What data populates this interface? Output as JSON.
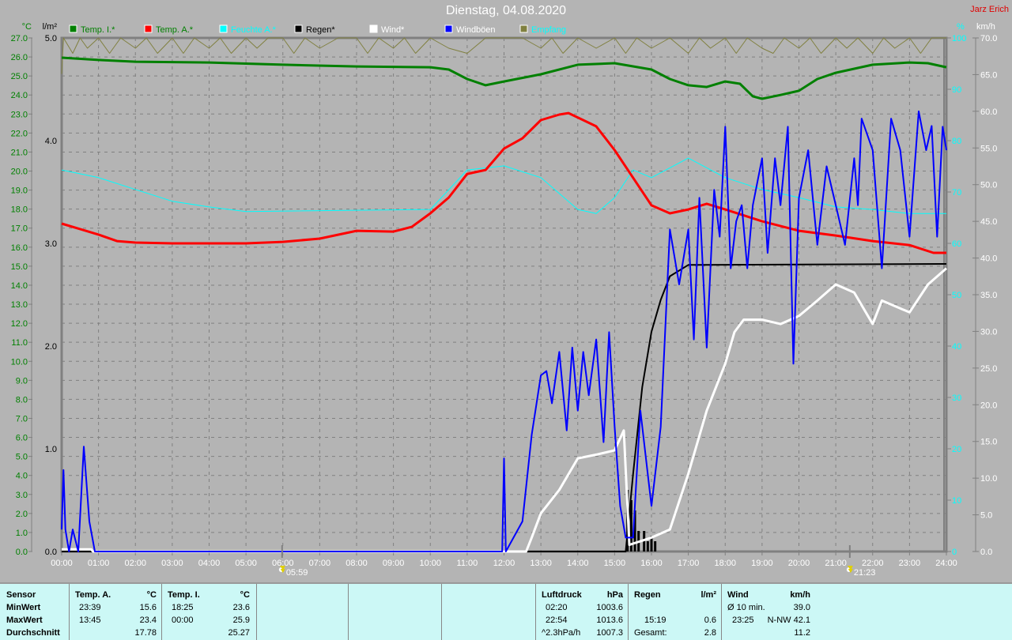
{
  "header": {
    "title": "Dienstag, 04.08.2020",
    "author": "Jarz Erich"
  },
  "chart_data": {
    "type": "line",
    "title": "Dienstag, 04.08.2020",
    "x_unit": "hours",
    "xlim": [
      0,
      24
    ],
    "x_ticks": [
      "00:00",
      "01:00",
      "02:00",
      "03:00",
      "04:00",
      "05:00",
      "06:00",
      "07:00",
      "08:00",
      "09:00",
      "10:00",
      "11:00",
      "12:00",
      "13:00",
      "14:00",
      "15:00",
      "16:00",
      "17:00",
      "18:00",
      "19:00",
      "20:00",
      "21:00",
      "22:00",
      "23:00",
      "24:00"
    ],
    "axes": {
      "temp": {
        "label": "°C",
        "ylim": [
          0,
          27
        ],
        "step": 1,
        "color": "#008000"
      },
      "rain": {
        "label": "l/m²",
        "ylim": [
          0,
          5
        ],
        "step": 1,
        "color": "#000000"
      },
      "humidity": {
        "label": "%",
        "ylim": [
          0,
          100
        ],
        "step": 10,
        "color": "#00ffff"
      },
      "wind": {
        "label": "km/h",
        "ylim": [
          0,
          70
        ],
        "step": 5,
        "color": "#ffffff"
      }
    },
    "sun": {
      "sunrise": "05:59",
      "sunset": "21:23",
      "sunrise_h": 5.98,
      "sunset_h": 21.38
    },
    "legend": [
      {
        "name": "Temp. I.*",
        "color": "#008000",
        "text_color": "#008000"
      },
      {
        "name": "Temp. A.*",
        "color": "#ff0000",
        "text_color": "#008000"
      },
      {
        "name": "Feuchte A.*",
        "color": "#00ffff",
        "text_color": "#00ffff"
      },
      {
        "name": "Regen*",
        "color": "#000000",
        "text_color": "#000000"
      },
      {
        "name": "Wind*",
        "color": "#ffffff",
        "text_color": "#ffffff"
      },
      {
        "name": "Windböen",
        "color": "#0000ff",
        "text_color": "#ffffff"
      },
      {
        "name": "Empfang",
        "color": "#808040",
        "text_color": "#00ffff"
      }
    ],
    "series": [
      {
        "name": "Empfang",
        "axis": "humidity",
        "color": "#808040",
        "width": 1,
        "x": [
          0,
          0.05,
          0.3,
          0.5,
          0.7,
          1,
          1.3,
          1.6,
          2,
          2.3,
          2.6,
          3,
          3.3,
          3.6,
          4,
          4.3,
          4.6,
          5,
          5.3,
          5.6,
          6,
          6.3,
          6.6,
          7,
          7.5,
          8,
          8.3,
          8.6,
          9,
          9.3,
          9.6,
          10,
          10.5,
          11,
          11.5,
          12,
          12.5,
          13,
          13.3,
          13.6,
          14,
          14.5,
          15,
          15.3,
          15.6,
          16,
          16.5,
          17,
          17.3,
          17.6,
          18,
          18.3,
          18.6,
          19,
          19.3,
          19.6,
          20,
          20.3,
          20.6,
          21,
          21.3,
          21.6,
          22,
          22.3,
          22.6,
          23,
          23.3,
          23.6,
          24
        ],
        "y": [
          93,
          100,
          97,
          100,
          98,
          100,
          97,
          100,
          98,
          100,
          97,
          100,
          97,
          100,
          98,
          100,
          97,
          100,
          98,
          100,
          100,
          97,
          100,
          98,
          100,
          100,
          97,
          100,
          98,
          100,
          97,
          100,
          98,
          97,
          100,
          100,
          100,
          98,
          100,
          97,
          100,
          98,
          100,
          97,
          100,
          98,
          100,
          97,
          100,
          98,
          100,
          97,
          100,
          98,
          97,
          100,
          98,
          100,
          97,
          100,
          98,
          100,
          97,
          100,
          98,
          100,
          97,
          100,
          100
        ]
      },
      {
        "name": "Temp. I.*",
        "axis": "temp",
        "color": "#008000",
        "width": 3,
        "x": [
          0,
          1,
          2,
          4,
          6,
          8,
          10,
          10.5,
          11,
          11.5,
          12,
          13,
          14,
          15,
          16,
          16.5,
          17,
          17.5,
          18,
          18.4,
          18.75,
          19,
          19.5,
          20,
          20.5,
          21,
          22,
          23,
          23.5,
          24
        ],
        "y": [
          25.96,
          25.84,
          25.75,
          25.71,
          25.59,
          25.5,
          25.46,
          25.34,
          24.84,
          24.51,
          24.71,
          25.09,
          25.59,
          25.67,
          25.34,
          24.84,
          24.51,
          24.42,
          24.71,
          24.59,
          23.93,
          23.8,
          24.0,
          24.22,
          24.84,
          25.17,
          25.59,
          25.71,
          25.67,
          25.46
        ]
      },
      {
        "name": "Feuchte A.*",
        "axis": "humidity",
        "color": "#00ffff",
        "width": 1,
        "x": [
          0,
          1,
          2,
          3,
          4,
          5,
          10,
          11,
          12,
          13,
          14,
          14.5,
          15,
          15.5,
          16,
          17,
          18,
          19,
          20,
          21,
          22,
          23,
          24
        ],
        "y": [
          74.3,
          72.8,
          70.5,
          68.2,
          67.1,
          66.2,
          66.6,
          74.3,
          75.1,
          72.8,
          66.6,
          65.8,
          68.9,
          74.3,
          72.8,
          76.6,
          72.8,
          70.5,
          68.9,
          67.1,
          66.6,
          65.8,
          65.8
        ]
      },
      {
        "name": "Regen*",
        "axis": "rain",
        "color": "#000000",
        "width": 2,
        "x": [
          0,
          15.3,
          15.5,
          15.75,
          16,
          16.25,
          16.5,
          17,
          24
        ],
        "y": [
          0,
          0,
          0.75,
          1.6,
          2.14,
          2.45,
          2.68,
          2.79,
          2.8
        ]
      },
      {
        "name": "Wind*",
        "axis": "wind",
        "color": "#ffffff",
        "width": 3,
        "x": [
          0,
          0.8,
          0.85,
          12.6,
          12.75,
          13,
          13.5,
          14,
          14.5,
          15,
          15.25,
          15.4,
          16,
          16.5,
          17,
          17.5,
          18,
          18.25,
          18.5,
          19,
          19.5,
          20,
          20.5,
          21,
          21.5,
          22,
          22.25,
          23,
          23.5,
          24
        ],
        "y": [
          0.3,
          0.3,
          0,
          0,
          1.9,
          5.2,
          8.4,
          12.7,
          13.2,
          13.8,
          16.5,
          0.9,
          1.9,
          3.0,
          10.6,
          19.2,
          25.6,
          29.9,
          31.6,
          31.6,
          31.0,
          32.1,
          34.2,
          36.4,
          35.3,
          31.0,
          34.2,
          32.6,
          36.4,
          38.6
        ]
      },
      {
        "name": "Temp. A.*",
        "axis": "temp",
        "color": "#ff0000",
        "width": 3,
        "x": [
          0,
          0.5,
          1,
          1.5,
          2,
          3,
          5,
          6,
          7,
          8,
          9,
          9.5,
          10,
          10.5,
          11,
          11.5,
          12,
          12.5,
          13,
          13.5,
          13.75,
          14.5,
          15,
          15.5,
          16,
          16.5,
          17,
          17.5,
          18,
          19,
          20,
          21,
          22,
          23,
          23.65,
          24
        ],
        "y": [
          17.24,
          16.95,
          16.66,
          16.32,
          16.24,
          16.2,
          16.2,
          16.28,
          16.45,
          16.86,
          16.82,
          17.07,
          17.78,
          18.61,
          19.85,
          20.06,
          21.18,
          21.72,
          22.68,
          22.97,
          23.05,
          22.35,
          21.1,
          19.65,
          18.2,
          17.78,
          17.98,
          18.28,
          17.98,
          17.36,
          16.86,
          16.61,
          16.32,
          16.11,
          15.7,
          15.7
        ]
      },
      {
        "name": "Windböen",
        "axis": "wind",
        "color": "#0000ff",
        "width": 2,
        "x": [
          0,
          0.05,
          0.1,
          0.2,
          0.3,
          0.45,
          0.6,
          0.75,
          0.9,
          1.05,
          11.95,
          12,
          12.05,
          12.5,
          12.75,
          13,
          13.15,
          13.3,
          13.5,
          13.7,
          13.85,
          14,
          14.15,
          14.3,
          14.5,
          14.7,
          14.85,
          15,
          15.15,
          15.3,
          15.5,
          15.7,
          16,
          16.25,
          16.5,
          16.75,
          17,
          17.15,
          17.3,
          17.5,
          17.7,
          17.85,
          18,
          18.15,
          18.3,
          18.45,
          18.6,
          18.75,
          19,
          19.15,
          19.35,
          19.5,
          19.7,
          19.85,
          20,
          20.25,
          20.5,
          20.75,
          21,
          21.25,
          21.5,
          21.6,
          21.7,
          22,
          22.25,
          22.5,
          22.75,
          23,
          23.25,
          23.45,
          23.6,
          23.75,
          23.9,
          24
        ],
        "y": [
          3.0,
          11.1,
          3.0,
          0,
          3.0,
          0,
          14.3,
          4.1,
          0,
          0,
          0,
          12.7,
          0,
          4.1,
          15.9,
          24.0,
          24.6,
          20.2,
          27.2,
          16.5,
          27.8,
          19.2,
          27.2,
          21.3,
          28.9,
          14.9,
          29.9,
          17.0,
          6.2,
          1.9,
          1.9,
          19.2,
          6.2,
          17.0,
          43.9,
          36.4,
          43.9,
          28.9,
          48.2,
          27.8,
          49.3,
          42.9,
          57.9,
          38.6,
          45.0,
          47.2,
          38.6,
          47.2,
          53.6,
          40.7,
          53.6,
          47.2,
          57.9,
          25.6,
          48.2,
          54.7,
          41.8,
          52.5,
          47.2,
          41.8,
          53.6,
          47.2,
          59.0,
          54.7,
          38.6,
          59.0,
          54.7,
          42.9,
          60.0,
          54.7,
          58.0,
          42.9,
          57.9,
          54.7
        ]
      }
    ],
    "rain_bars": {
      "x": [
        15.35,
        15.45,
        15.55,
        15.65,
        15.8,
        15.9,
        16.0,
        16.1
      ],
      "y": [
        0.6,
        0.5,
        0.4,
        0.2,
        0.2,
        0.1,
        0.15,
        0.1
      ]
    }
  },
  "footer": {
    "sensor": {
      "header": "Sensor",
      "rows": [
        "MinWert",
        "MaxWert",
        "Durchschnitt"
      ]
    },
    "temp_a": {
      "header": "Temp. A.",
      "unit": "°C",
      "min_time": "23:39",
      "min": "15.6",
      "max_time": "13:45",
      "max": "23.4",
      "avg": "17.78"
    },
    "temp_i": {
      "header": "Temp. I.",
      "unit": "°C",
      "min_time": "18:25",
      "min": "23.6",
      "max_time": "00:00",
      "max": "25.9",
      "avg": "25.27"
    },
    "pressure": {
      "header": "Luftdruck",
      "unit": "hPa",
      "min_time": "02:20",
      "min": "1003.6",
      "max_time": "22:54",
      "max": "1013.6",
      "trend": "^2.3hPa/h",
      "avg": "1007.3"
    },
    "rain": {
      "header": "Regen",
      "unit": "l/m²",
      "max_time": "15:19",
      "max": "0.6",
      "total_label": "Gesamt:",
      "total": "2.8"
    },
    "wind": {
      "header": "Wind",
      "unit": "km/h",
      "avg10_label": "Ø 10 min.",
      "avg10": "39.0",
      "max_time": "23:25",
      "max": "N-NW 42.1",
      "avg": "11.2"
    }
  }
}
